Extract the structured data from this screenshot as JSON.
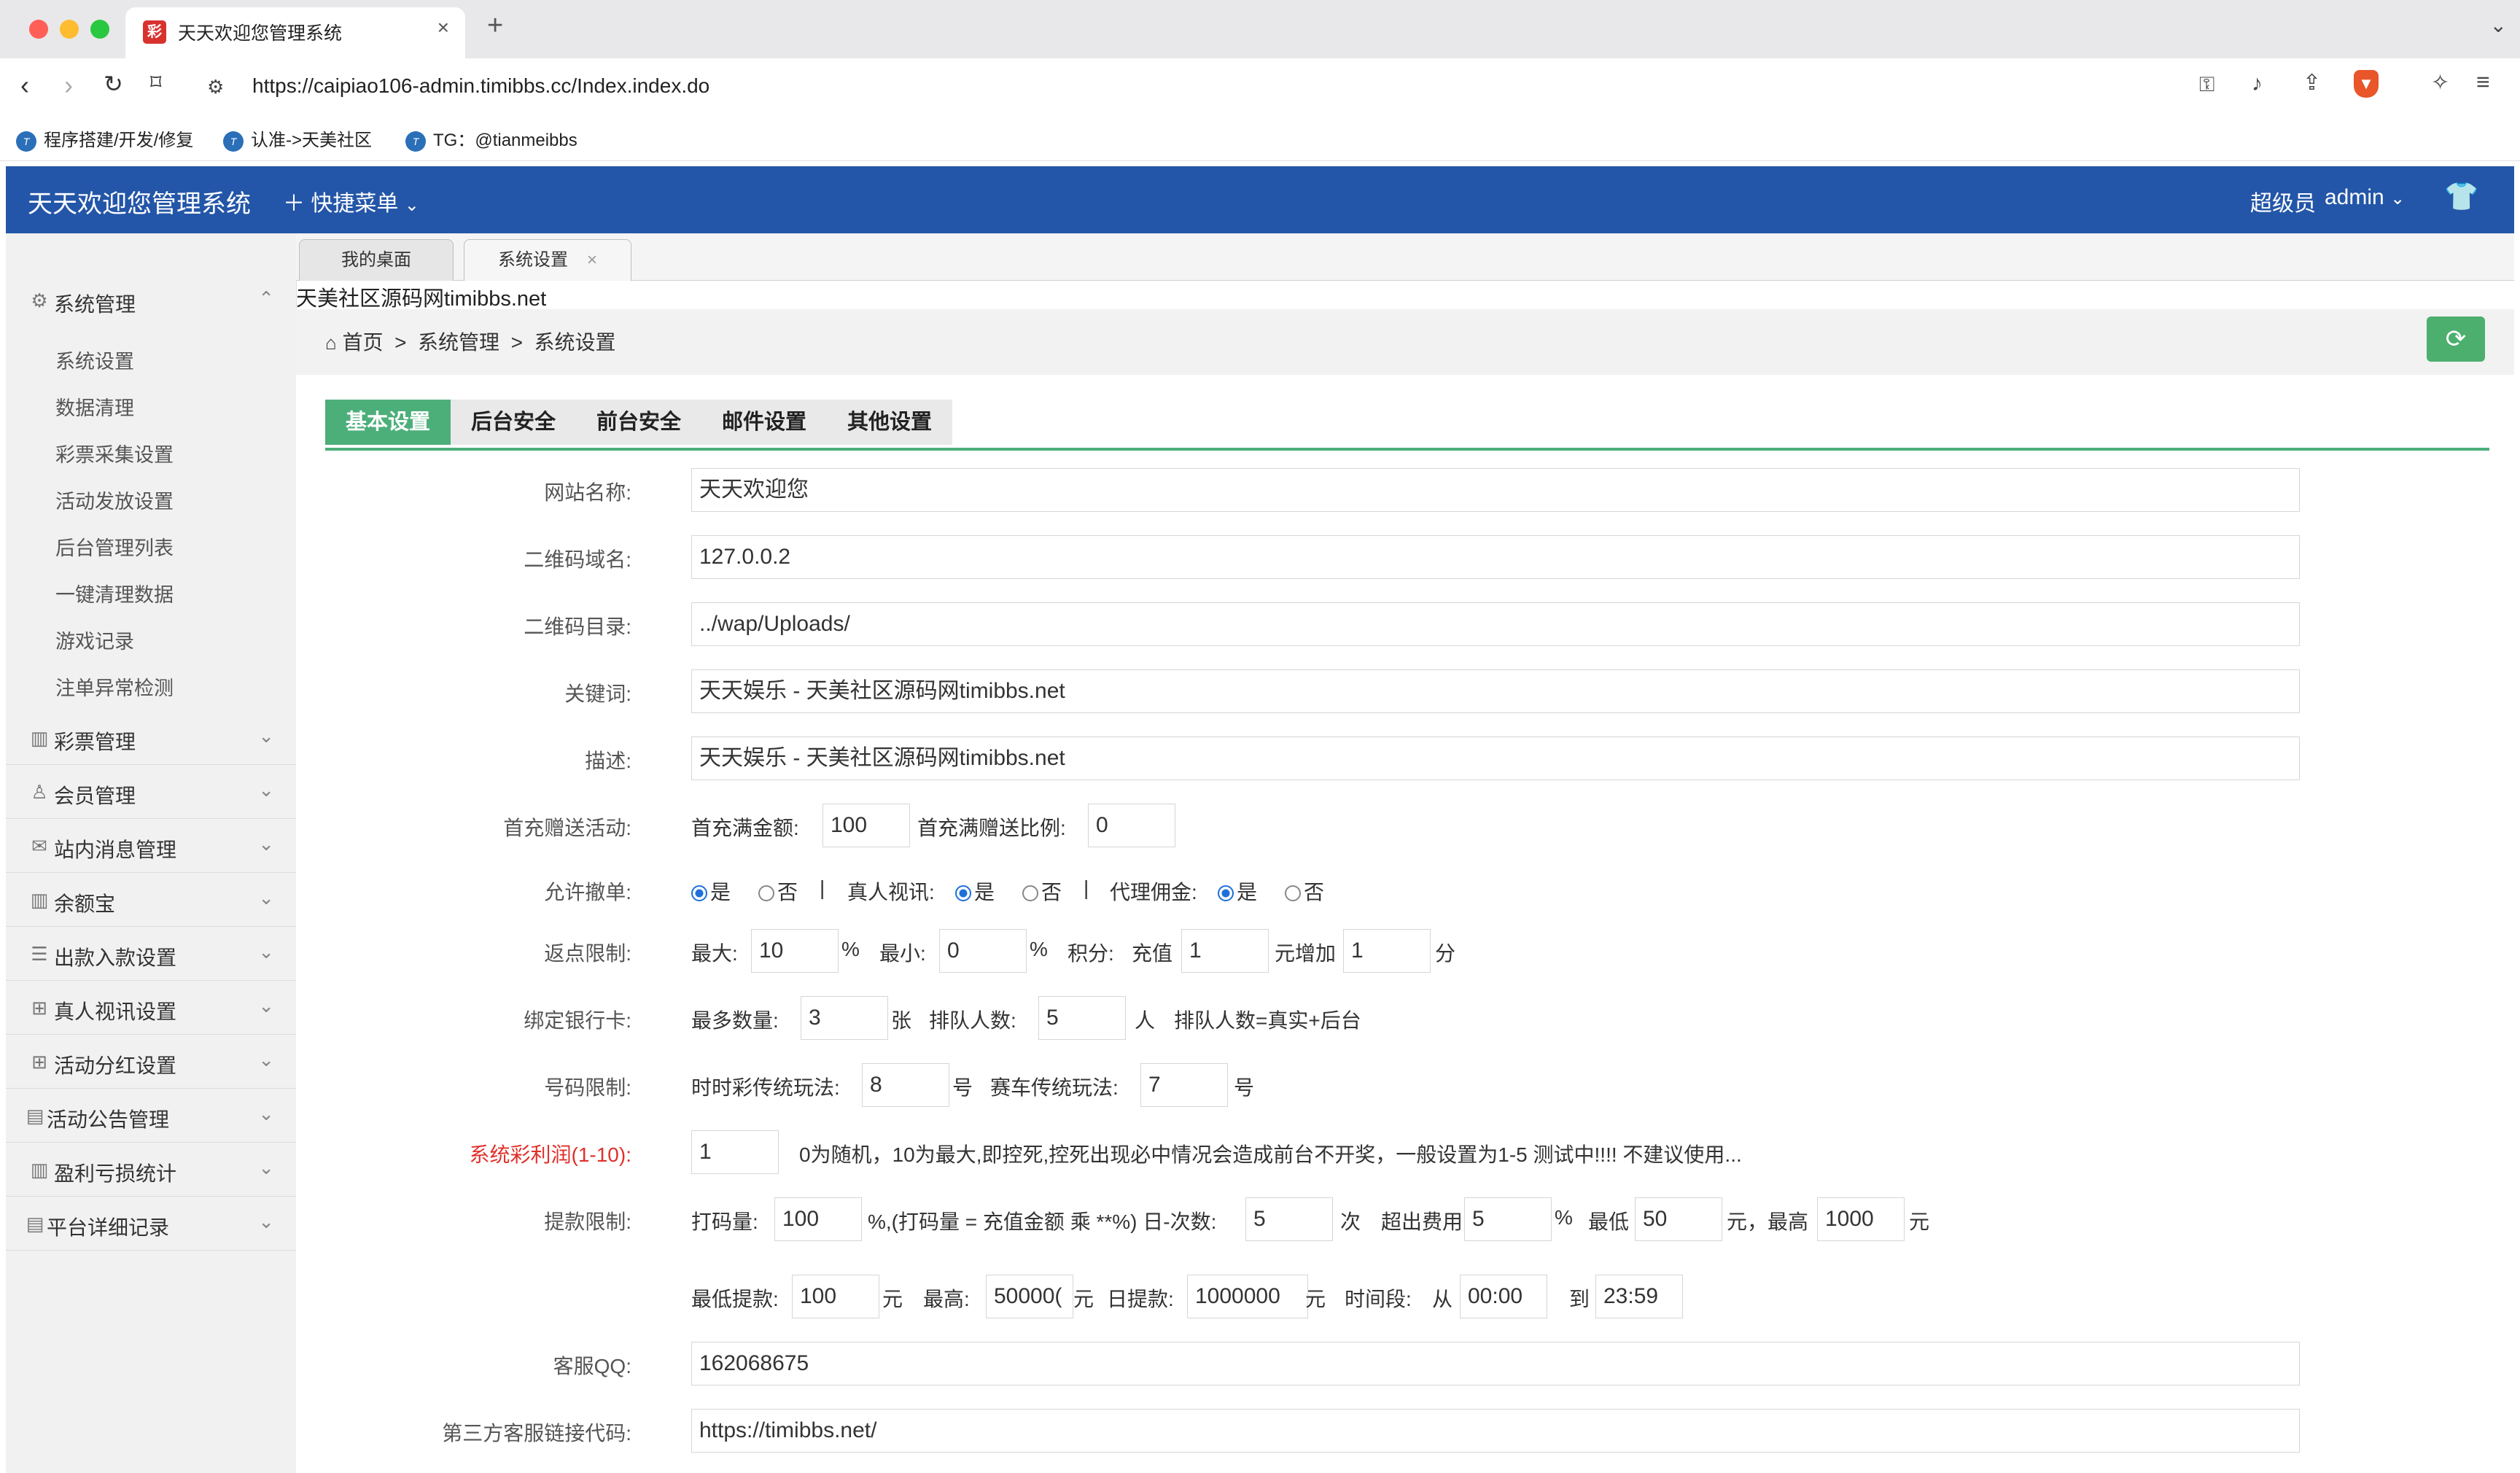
{
  "browser": {
    "tab_title": "天天欢迎您管理系统",
    "favicon_text": "彩",
    "url": "https://caipiao106-admin.timibbs.cc/Index.index.do",
    "bookmarks": [
      "程序搭建/开发/修复",
      "认准->天美社区",
      "TG：@tianmeibbs"
    ]
  },
  "header": {
    "title": "天天欢迎您管理系统",
    "quick_menu": "快捷菜单",
    "user_role": "超级员",
    "user_name": "admin"
  },
  "sidebar": {
    "groups": [
      {
        "label": "系统管理",
        "icon": "gear-icon",
        "expanded": true,
        "items": [
          "系统设置",
          "数据清理",
          "彩票采集设置",
          "活动发放设置",
          "后台管理列表",
          "一键清理数据",
          "游戏记录",
          "注单异常检测"
        ]
      },
      {
        "label": "彩票管理",
        "icon": "chart-icon"
      },
      {
        "label": "会员管理",
        "icon": "user-icon"
      },
      {
        "label": "站内消息管理",
        "icon": "mail-icon"
      },
      {
        "label": "余额宝",
        "icon": "chart-icon"
      },
      {
        "label": "出款入款设置",
        "icon": "list-icon"
      },
      {
        "label": "真人视讯设置",
        "icon": "gift-icon"
      },
      {
        "label": "活动分红设置",
        "icon": "gift-icon"
      },
      {
        "label": "活动公告管理",
        "icon": "doc-icon"
      },
      {
        "label": "盈利亏损统计",
        "icon": "chart-icon"
      },
      {
        "label": "平台详细记录",
        "icon": "doc-icon"
      }
    ]
  },
  "page_tabs": [
    "我的桌面",
    "系统设置"
  ],
  "notice": "天美社区源码网timibbs.net",
  "breadcrumb": {
    "home": "首页",
    "sep": ">",
    "level1": "系统管理",
    "level2": "系统设置"
  },
  "settings_tabs": [
    "基本设置",
    "后台安全",
    "前台安全",
    "邮件设置",
    "其他设置"
  ],
  "form": {
    "site_name": {
      "label": "网站名称:",
      "value": "天天欢迎您"
    },
    "qr_domain": {
      "label": "二维码域名:",
      "value": "127.0.0.2"
    },
    "qr_dir": {
      "label": "二维码目录:",
      "value": "../wap/Uploads/"
    },
    "keywords": {
      "label": "关键词:",
      "value": "天天娱乐 - 天美社区源码网timibbs.net"
    },
    "description": {
      "label": "描述:",
      "value": "天天娱乐 - 天美社区源码网timibbs.net"
    },
    "first_deposit": {
      "label": "首充赠送活动:",
      "amount_label": "首充满金额:",
      "amount": "100",
      "ratio_label": "首充满赠送比例:",
      "ratio": "0"
    },
    "allow": {
      "label": "允许撤单:",
      "yes": "是",
      "no": "否",
      "sep": "|",
      "live_label": "真人视讯:",
      "agent_label": "代理佣金:",
      "cancel": "yes",
      "live": "yes",
      "agent": "yes"
    },
    "rebate": {
      "label": "返点限制:",
      "max_label": "最大:",
      "max": "10",
      "pct": "%",
      "min_label": "最小:",
      "min": "0",
      "points_label": "积分:",
      "recharge_label": "充值",
      "recharge": "1",
      "add_label": "元增加",
      "add": "1",
      "unit": "分"
    },
    "bank": {
      "label": "绑定银行卡:",
      "max_label": "最多数量:",
      "max": "3",
      "unit1": "张",
      "queue_label": "排队人数:",
      "queue": "5",
      "unit2": "人",
      "note": "排队人数=真实+后台"
    },
    "number_limit": {
      "label": "号码限制:",
      "ssc_label": "时时彩传统玩法:",
      "ssc": "8",
      "unit": "号",
      "race_label": "赛车传统玩法:",
      "race": "7"
    },
    "profit": {
      "label": "系统彩利润(1-10):",
      "value": "1",
      "note": "0为随机，10为最大,即控死,控死出现必中情况会造成前台不开奖，一般设置为1-5 测试中!!!! 不建议使用..."
    },
    "withdraw": {
      "label": "提款限制:",
      "bet_label": "打码量:",
      "bet": "100",
      "bet_note": "%,(打码量 = 充值金额 乘 **%) 日-次数:",
      "times": "5",
      "times_unit": "次",
      "fee_label": "超出费用",
      "fee": "5",
      "fee_unit": "%",
      "min_label": "最低",
      "min": "50",
      "min_unit": "元，最高",
      "max": "1000",
      "yuan": "元",
      "min_withdraw_label": "最低提款:",
      "min_withdraw": "100",
      "high_label": "最高:",
      "high": "50000(",
      "daily_label": "日提款:",
      "daily": "1000000",
      "time_label": "时间段:",
      "from_label": "从",
      "from": "00:00",
      "to_label": "到",
      "to": "23:59"
    },
    "qq": {
      "label": "客服QQ:",
      "value": "162068675"
    },
    "third_party": {
      "label": "第三方客服链接代码:",
      "value": "https://timibbs.net/"
    }
  }
}
